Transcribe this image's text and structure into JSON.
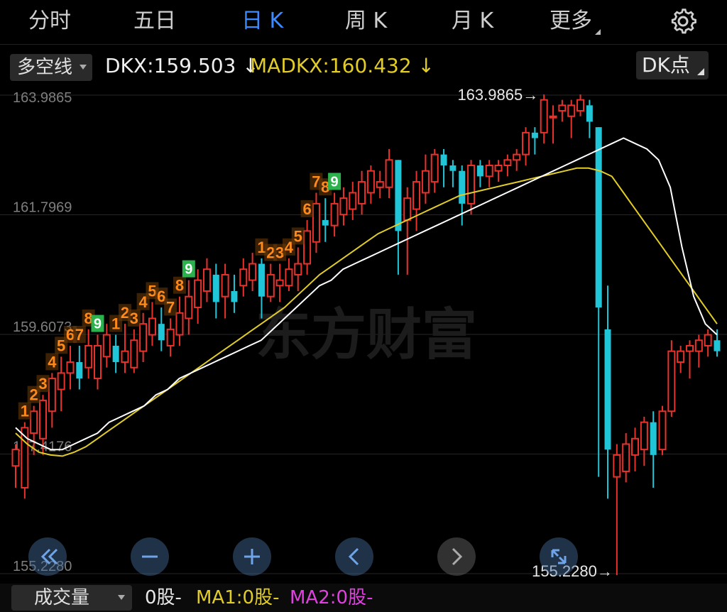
{
  "tabs": [
    {
      "label": "分时"
    },
    {
      "label": "五日"
    },
    {
      "label": "日 K"
    },
    {
      "label": "周 K"
    },
    {
      "label": "月 K"
    },
    {
      "label": "更多"
    }
  ],
  "active_tab": "日 K",
  "indicator": {
    "name": "多空线",
    "dkx": "DKX:159.503 ↓",
    "madkx": "MADKX:160.432 ↓",
    "dk_point": "DK点"
  },
  "watermark": "东方财富",
  "colors": {
    "up": "#e8322c",
    "down": "#21c5d8",
    "dkx": "#ffffff",
    "madkx": "#e2cc28",
    "count": "#ff8a1c",
    "nine": "#2bb24c"
  },
  "icons": [
    "gear-icon",
    "double-left-icon",
    "minus-icon",
    "plus-icon",
    "left-icon",
    "right-icon",
    "reset-icon"
  ],
  "chart_data": {
    "type": "candlestick",
    "y_axis_labels": [
      "163.9865",
      "161.7969",
      "159.6073",
      "157.4176",
      "155.2280"
    ],
    "ylim": [
      155.228,
      163.9865
    ],
    "high_label": "163.9865→",
    "low_label": "155.2280→",
    "candles": [
      [
        157.2,
        157.5,
        156.8,
        157.6
      ],
      [
        156.8,
        157.9,
        156.6,
        158.0
      ],
      [
        157.8,
        158.2,
        157.4,
        158.3
      ],
      [
        157.7,
        158.4,
        157.4,
        158.5
      ],
      [
        158.2,
        158.8,
        157.9,
        158.9
      ],
      [
        158.6,
        158.9,
        158.2,
        159.2
      ],
      [
        158.9,
        159.1,
        158.6,
        159.4
      ],
      [
        159.1,
        158.8,
        158.6,
        159.4
      ],
      [
        159.0,
        159.4,
        158.8,
        159.7
      ],
      [
        158.8,
        159.4,
        158.6,
        159.6
      ],
      [
        159.2,
        159.6,
        159.0,
        159.8
      ],
      [
        159.4,
        159.1,
        158.9,
        159.6
      ],
      [
        159.1,
        159.3,
        158.9,
        159.8
      ],
      [
        159.0,
        159.5,
        158.9,
        159.7
      ],
      [
        159.3,
        159.8,
        159.1,
        160.0
      ],
      [
        159.6,
        159.9,
        159.4,
        160.2
      ],
      [
        159.8,
        159.5,
        159.3,
        160.1
      ],
      [
        159.4,
        159.7,
        159.2,
        159.9
      ],
      [
        159.6,
        160.0,
        159.4,
        160.3
      ],
      [
        159.9,
        160.3,
        159.6,
        160.6
      ],
      [
        160.1,
        160.6,
        159.8,
        160.8
      ],
      [
        160.4,
        160.8,
        160.2,
        161.0
      ],
      [
        160.7,
        160.2,
        159.9,
        160.9
      ],
      [
        160.3,
        160.7,
        159.9,
        160.9
      ],
      [
        160.4,
        160.2,
        160.0,
        160.7
      ],
      [
        160.5,
        160.8,
        160.3,
        161.0
      ],
      [
        160.6,
        160.9,
        160.4,
        161.1
      ],
      [
        160.9,
        160.3,
        159.9,
        161.0
      ],
      [
        160.3,
        160.7,
        160.2,
        160.9
      ],
      [
        160.5,
        160.6,
        160.2,
        160.9
      ],
      [
        160.5,
        160.8,
        160.4,
        161.0
      ],
      [
        160.7,
        160.9,
        160.4,
        161.2
      ],
      [
        160.9,
        161.5,
        160.7,
        161.7
      ],
      [
        161.3,
        162.0,
        161.1,
        162.2
      ],
      [
        161.7,
        161.6,
        161.3,
        162.1
      ],
      [
        161.6,
        162.0,
        161.4,
        162.2
      ],
      [
        161.8,
        162.1,
        161.6,
        162.3
      ],
      [
        161.9,
        162.2,
        161.7,
        162.4
      ],
      [
        162.0,
        162.4,
        161.8,
        162.6
      ],
      [
        162.2,
        162.6,
        162.0,
        162.7
      ],
      [
        162.3,
        162.4,
        162.1,
        162.6
      ],
      [
        162.3,
        162.8,
        162.1,
        163.0
      ],
      [
        162.8,
        161.5,
        160.7,
        162.8
      ],
      [
        161.7,
        162.1,
        160.7,
        162.3
      ],
      [
        161.9,
        162.4,
        161.5,
        162.6
      ],
      [
        162.2,
        162.6,
        162.0,
        162.9
      ],
      [
        162.4,
        162.9,
        162.2,
        163.0
      ],
      [
        162.9,
        162.7,
        162.3,
        163.0
      ],
      [
        162.7,
        162.6,
        162.3,
        162.8
      ],
      [
        162.6,
        162.0,
        161.6,
        162.7
      ],
      [
        162.0,
        162.7,
        161.8,
        162.8
      ],
      [
        162.7,
        162.5,
        162.3,
        162.8
      ],
      [
        162.5,
        162.7,
        162.3,
        162.8
      ],
      [
        162.6,
        162.7,
        162.4,
        162.8
      ],
      [
        162.7,
        162.8,
        162.5,
        162.9
      ],
      [
        162.8,
        162.9,
        162.6,
        163.0
      ],
      [
        162.9,
        163.3,
        162.7,
        163.4
      ],
      [
        163.3,
        163.2,
        162.9,
        163.4
      ],
      [
        163.3,
        163.9,
        163.1,
        164.0
      ],
      [
        163.6,
        163.6,
        163.1,
        163.8
      ],
      [
        163.7,
        163.8,
        163.5,
        163.9
      ],
      [
        163.6,
        163.8,
        163.2,
        163.9
      ],
      [
        163.7,
        163.9,
        163.6,
        164.0
      ],
      [
        163.8,
        163.5,
        163.2,
        163.9
      ],
      [
        163.4,
        160.1,
        157.0,
        163.4
      ],
      [
        159.7,
        157.5,
        156.6,
        160.5
      ],
      [
        157.0,
        157.4,
        155.2,
        157.6
      ],
      [
        157.1,
        157.6,
        156.9,
        157.8
      ],
      [
        157.4,
        157.7,
        157.1,
        157.9
      ],
      [
        157.5,
        158.0,
        157.2,
        158.1
      ],
      [
        158.0,
        157.4,
        156.8,
        158.2
      ],
      [
        157.5,
        158.2,
        157.4,
        158.3
      ],
      [
        158.2,
        159.3,
        158.1,
        159.5
      ],
      [
        159.1,
        159.3,
        158.9,
        159.4
      ],
      [
        159.3,
        159.4,
        158.8,
        159.5
      ],
      [
        159.3,
        159.5,
        159.0,
        159.6
      ],
      [
        159.4,
        159.6,
        159.2,
        159.7
      ],
      [
        159.5,
        159.3,
        159.2,
        159.7
      ]
    ],
    "dkx_line": [
      157.9,
      157.7,
      157.6,
      157.5,
      157.5,
      157.6,
      157.7,
      157.8,
      158.0,
      158.1,
      158.2,
      158.3,
      158.5,
      158.6,
      158.8,
      158.9,
      159.0,
      159.1,
      159.2,
      159.3,
      159.4,
      159.5,
      159.7,
      159.9,
      160.1,
      160.3,
      160.5,
      160.6,
      160.8,
      160.9,
      161.0,
      161.1,
      161.2,
      161.3,
      161.4,
      161.5,
      161.6,
      161.7,
      161.8,
      161.9,
      162.0,
      162.1,
      162.2,
      162.3,
      162.4,
      162.5,
      162.6,
      162.7,
      162.8,
      162.9,
      163.0,
      163.1,
      163.2,
      163.1,
      163.0,
      162.8,
      162.3,
      161.2,
      160.3,
      159.8,
      159.6
    ],
    "madkx_line": [
      157.8,
      157.6,
      157.45,
      157.4,
      157.38,
      157.45,
      157.55,
      157.7,
      157.85,
      158.0,
      158.15,
      158.3,
      158.45,
      158.6,
      158.75,
      158.9,
      159.05,
      159.2,
      159.35,
      159.5,
      159.65,
      159.8,
      159.95,
      160.1,
      160.3,
      160.5,
      160.7,
      160.85,
      161.0,
      161.15,
      161.3,
      161.45,
      161.55,
      161.65,
      161.75,
      161.85,
      161.95,
      162.05,
      162.15,
      162.2,
      162.25,
      162.3,
      162.35,
      162.4,
      162.45,
      162.5,
      162.55,
      162.6,
      162.65,
      162.65,
      162.6,
      162.5,
      162.2,
      161.9,
      161.6,
      161.3,
      161.0,
      160.7,
      160.4,
      160.1,
      159.8
    ],
    "td_counts": [
      {
        "candle": 1,
        "label": "1"
      },
      {
        "candle": 2,
        "label": "2"
      },
      {
        "candle": 3,
        "label": "3"
      },
      {
        "candle": 4,
        "label": "4"
      },
      {
        "candle": 5,
        "label": "5"
      },
      {
        "candle": 6,
        "label": "6"
      },
      {
        "candle": 7,
        "label": "7"
      },
      {
        "candle": 8,
        "label": "8"
      },
      {
        "candle": 9,
        "label": "9"
      },
      {
        "candle": 11,
        "label": "1"
      },
      {
        "candle": 12,
        "label": "2"
      },
      {
        "candle": 13,
        "label": "3"
      },
      {
        "candle": 14,
        "label": "4"
      },
      {
        "candle": 15,
        "label": "5"
      },
      {
        "candle": 16,
        "label": "6"
      },
      {
        "candle": 17,
        "label": "7"
      },
      {
        "candle": 18,
        "label": "8"
      },
      {
        "candle": 19,
        "label": "9"
      },
      {
        "candle": 27,
        "label": "1"
      },
      {
        "candle": 28,
        "label": "2"
      },
      {
        "candle": 29,
        "label": "3"
      },
      {
        "candle": 30,
        "label": "4"
      },
      {
        "candle": 31,
        "label": "5"
      },
      {
        "candle": 32,
        "label": "6"
      },
      {
        "candle": 33,
        "label": "7"
      },
      {
        "candle": 34,
        "label": "8"
      },
      {
        "candle": 35,
        "label": "9"
      }
    ]
  },
  "volume_bar": {
    "dropdown": "成交量",
    "value": "0股-",
    "ma1": "MA1:0股-",
    "ma2": "MA2:0股-"
  }
}
